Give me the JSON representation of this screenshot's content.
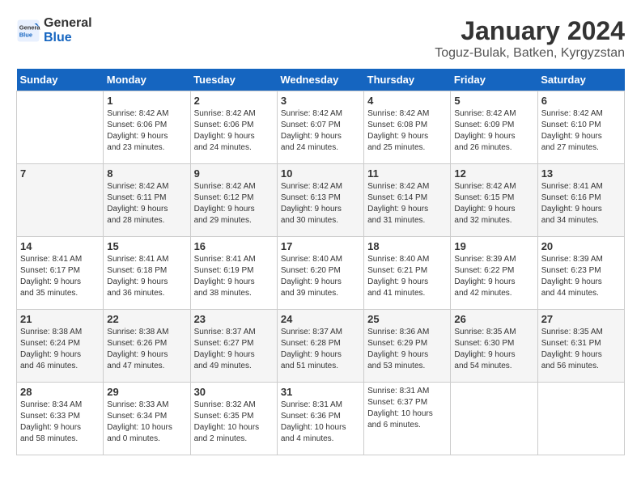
{
  "header": {
    "logo_line1": "General",
    "logo_line2": "Blue",
    "month_year": "January 2024",
    "location": "Toguz-Bulak, Batken, Kyrgyzstan"
  },
  "days_of_week": [
    "Sunday",
    "Monday",
    "Tuesday",
    "Wednesday",
    "Thursday",
    "Friday",
    "Saturday"
  ],
  "weeks": [
    [
      {
        "day": "",
        "info": ""
      },
      {
        "day": "1",
        "info": "Sunrise: 8:42 AM\nSunset: 6:06 PM\nDaylight: 9 hours\nand 23 minutes."
      },
      {
        "day": "2",
        "info": "Sunrise: 8:42 AM\nSunset: 6:06 PM\nDaylight: 9 hours\nand 24 minutes."
      },
      {
        "day": "3",
        "info": "Sunrise: 8:42 AM\nSunset: 6:07 PM\nDaylight: 9 hours\nand 24 minutes."
      },
      {
        "day": "4",
        "info": "Sunrise: 8:42 AM\nSunset: 6:08 PM\nDaylight: 9 hours\nand 25 minutes."
      },
      {
        "day": "5",
        "info": "Sunrise: 8:42 AM\nSunset: 6:09 PM\nDaylight: 9 hours\nand 26 minutes."
      },
      {
        "day": "6",
        "info": "Sunrise: 8:42 AM\nSunset: 6:10 PM\nDaylight: 9 hours\nand 27 minutes."
      }
    ],
    [
      {
        "day": "7",
        "info": ""
      },
      {
        "day": "8",
        "info": "Sunrise: 8:42 AM\nSunset: 6:11 PM\nDaylight: 9 hours\nand 28 minutes."
      },
      {
        "day": "9",
        "info": "Sunrise: 8:42 AM\nSunset: 6:12 PM\nDaylight: 9 hours\nand 29 minutes."
      },
      {
        "day": "10",
        "info": "Sunrise: 8:42 AM\nSunset: 6:13 PM\nDaylight: 9 hours\nand 30 minutes."
      },
      {
        "day": "11",
        "info": "Sunrise: 8:42 AM\nSunset: 6:14 PM\nDaylight: 9 hours\nand 31 minutes."
      },
      {
        "day": "12",
        "info": "Sunrise: 8:42 AM\nSunset: 6:15 PM\nDaylight: 9 hours\nand 32 minutes."
      },
      {
        "day": "13",
        "info": "Sunrise: 8:41 AM\nSunset: 6:16 PM\nDaylight: 9 hours\nand 34 minutes."
      }
    ],
    [
      {
        "day": "14",
        "info": "Sunrise: 8:41 AM\nSunset: 6:17 PM\nDaylight: 9 hours\nand 35 minutes."
      },
      {
        "day": "15",
        "info": "Sunrise: 8:41 AM\nSunset: 6:18 PM\nDaylight: 9 hours\nand 36 minutes."
      },
      {
        "day": "16",
        "info": "Sunrise: 8:41 AM\nSunset: 6:19 PM\nDaylight: 9 hours\nand 38 minutes."
      },
      {
        "day": "17",
        "info": "Sunrise: 8:40 AM\nSunset: 6:20 PM\nDaylight: 9 hours\nand 39 minutes."
      },
      {
        "day": "18",
        "info": "Sunrise: 8:40 AM\nSunset: 6:21 PM\nDaylight: 9 hours\nand 41 minutes."
      },
      {
        "day": "19",
        "info": "Sunrise: 8:39 AM\nSunset: 6:22 PM\nDaylight: 9 hours\nand 42 minutes."
      },
      {
        "day": "20",
        "info": "Sunrise: 8:39 AM\nSunset: 6:23 PM\nDaylight: 9 hours\nand 44 minutes."
      }
    ],
    [
      {
        "day": "21",
        "info": "Sunrise: 8:38 AM\nSunset: 6:24 PM\nDaylight: 9 hours\nand 46 minutes."
      },
      {
        "day": "22",
        "info": "Sunrise: 8:38 AM\nSunset: 6:26 PM\nDaylight: 9 hours\nand 47 minutes."
      },
      {
        "day": "23",
        "info": "Sunrise: 8:37 AM\nSunset: 6:27 PM\nDaylight: 9 hours\nand 49 minutes."
      },
      {
        "day": "24",
        "info": "Sunrise: 8:37 AM\nSunset: 6:28 PM\nDaylight: 9 hours\nand 51 minutes."
      },
      {
        "day": "25",
        "info": "Sunrise: 8:36 AM\nSunset: 6:29 PM\nDaylight: 9 hours\nand 53 minutes."
      },
      {
        "day": "26",
        "info": "Sunrise: 8:35 AM\nSunset: 6:30 PM\nDaylight: 9 hours\nand 54 minutes."
      },
      {
        "day": "27",
        "info": "Sunrise: 8:35 AM\nSunset: 6:31 PM\nDaylight: 9 hours\nand 56 minutes."
      }
    ],
    [
      {
        "day": "28",
        "info": "Sunrise: 8:34 AM\nSunset: 6:33 PM\nDaylight: 9 hours\nand 58 minutes."
      },
      {
        "day": "29",
        "info": "Sunrise: 8:33 AM\nSunset: 6:34 PM\nDaylight: 10 hours\nand 0 minutes."
      },
      {
        "day": "30",
        "info": "Sunrise: 8:32 AM\nSunset: 6:35 PM\nDaylight: 10 hours\nand 2 minutes."
      },
      {
        "day": "31",
        "info": "Sunrise: 8:31 AM\nSunset: 6:36 PM\nDaylight: 10 hours\nand 4 minutes."
      },
      {
        "day": "",
        "info": "Sunrise: 8:31 AM\nSunset: 6:37 PM\nDaylight: 10 hours\nand 6 minutes."
      },
      {
        "day": "",
        "info": ""
      },
      {
        "day": "",
        "info": ""
      }
    ]
  ]
}
